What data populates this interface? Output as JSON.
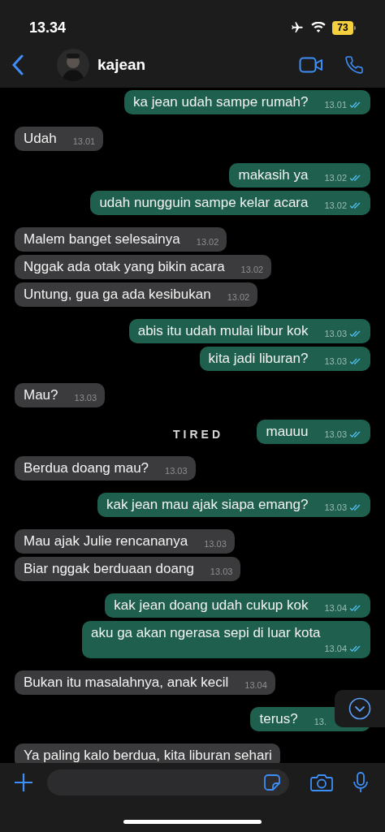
{
  "status_bar": {
    "time": "13.34",
    "battery": "73"
  },
  "header": {
    "contact_name": "kajean"
  },
  "wallpaper_text": "TIRED",
  "messages": [
    {
      "outgoing": true,
      "text": "ka jean udah sampe rumah?",
      "time": "13.01",
      "read": true
    },
    {
      "outgoing": false,
      "text": "Udah",
      "time": "13.01"
    },
    {
      "outgoing": true,
      "text": "makasih ya",
      "time": "13.02",
      "read": true
    },
    {
      "outgoing": true,
      "text": "udah nungguin sampe kelar acara",
      "time": "13.02",
      "read": true
    },
    {
      "outgoing": false,
      "text": "Malem banget selesainya",
      "time": "13.02"
    },
    {
      "outgoing": false,
      "text": "Nggak ada otak yang bikin acara",
      "time": "13.02"
    },
    {
      "outgoing": false,
      "text": "Untung, gua ga ada kesibukan",
      "time": "13.02"
    },
    {
      "outgoing": true,
      "text": "abis itu udah mulai libur kok",
      "time": "13.03",
      "read": true
    },
    {
      "outgoing": true,
      "text": "kita jadi liburan?",
      "time": "13.03",
      "read": true
    },
    {
      "outgoing": false,
      "text": "Mau?",
      "time": "13.03"
    },
    {
      "outgoing": true,
      "text": "mauuu",
      "time": "13.03",
      "read": true
    },
    {
      "outgoing": false,
      "text": "Berdua doang mau?",
      "time": "13.03"
    },
    {
      "outgoing": true,
      "text": "kak jean mau ajak siapa emang?",
      "time": "13.03",
      "read": true
    },
    {
      "outgoing": false,
      "text": "Mau ajak Julie rencananya",
      "time": "13.03"
    },
    {
      "outgoing": false,
      "text": "Biar nggak berduaan doang",
      "time": "13.03"
    },
    {
      "outgoing": true,
      "text": "kak jean doang udah cukup kok",
      "time": "13.04",
      "read": true
    },
    {
      "outgoing": true,
      "text": "aku ga akan ngerasa sepi di luar kota",
      "time": "13.04",
      "read": true
    },
    {
      "outgoing": false,
      "text": "Bukan itu masalahnya, anak kecil",
      "time": "13.04"
    },
    {
      "outgoing": true,
      "text": "terus?",
      "time": "13."
    },
    {
      "outgoing": false,
      "text": "Ya paling kalo berdua, kita liburan sehari"
    }
  ]
}
